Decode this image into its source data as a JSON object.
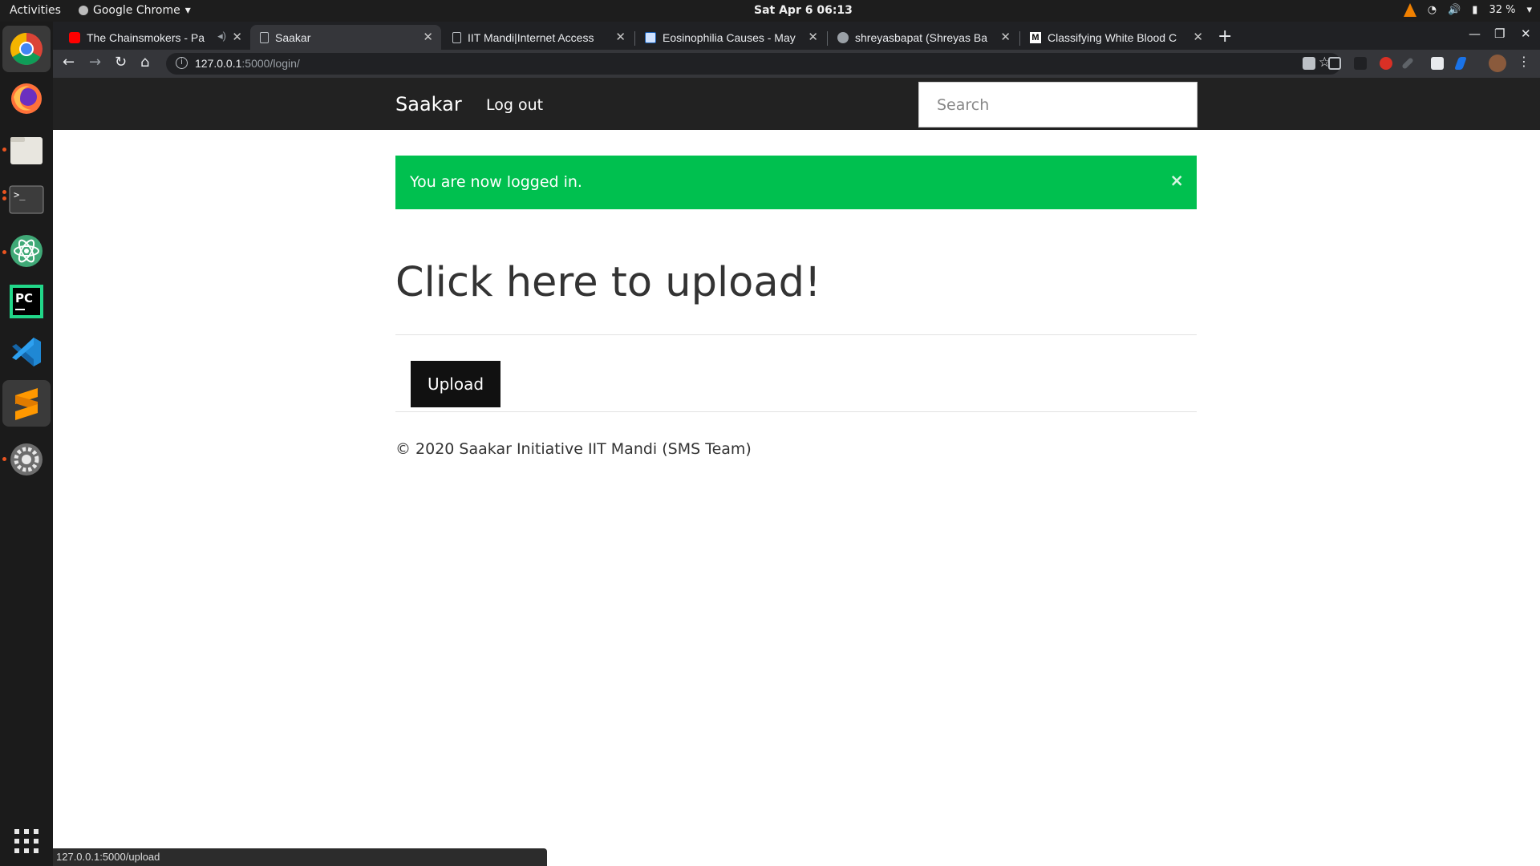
{
  "system": {
    "activities": "Activities",
    "app_name": "Google Chrome",
    "clock": "Sat Apr 6  06:13",
    "battery": "32 %"
  },
  "browser": {
    "tabs": [
      {
        "title": "The Chainsmokers - Pa",
        "icon": "youtube-icon"
      },
      {
        "title": "Saakar",
        "icon": "page-icon"
      },
      {
        "title": "IIT Mandi|Internet Access",
        "icon": "page-icon"
      },
      {
        "title": "Eosinophilia Causes - May",
        "icon": "mayo-icon"
      },
      {
        "title": "shreyasbapat (Shreyas Ba",
        "icon": "github-icon"
      },
      {
        "title": "Classifying White Blood C",
        "icon": "medium-icon"
      }
    ],
    "url_host": "127.0.0.1",
    "url_path": ":5000/login/"
  },
  "site": {
    "brand": "Saakar",
    "nav_logout": "Log out",
    "search_placeholder": "Search",
    "alert_message": "You are now logged in.",
    "alert_close": "×",
    "heading": "Click here to upload!",
    "upload_button": "Upload",
    "footer": "© 2020 Saakar Initiative IIT Mandi (SMS Team)"
  },
  "status_bar": "127.0.0.1:5000/upload",
  "colors": {
    "alert_green": "#00c04f",
    "navbar": "#222222",
    "button": "#111111"
  }
}
